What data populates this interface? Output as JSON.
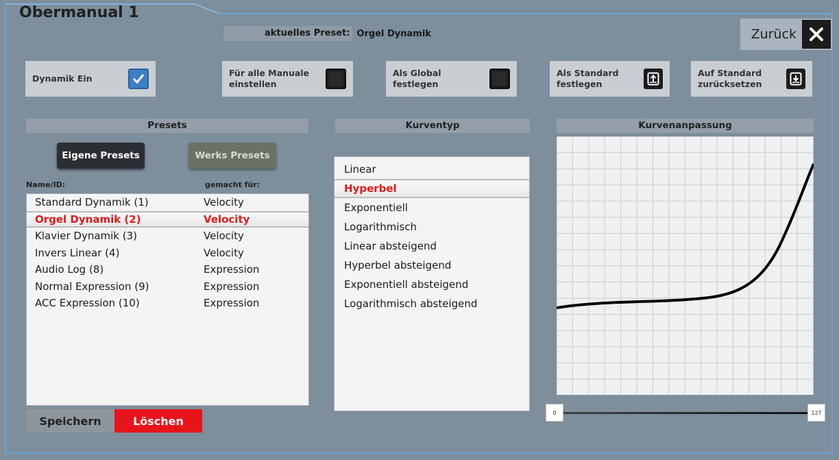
{
  "window": {
    "title": "Obermanual 1"
  },
  "current_preset": {
    "label": "aktuelles Preset:",
    "value": "Orgel Dynamik"
  },
  "back_button": {
    "label": "Zurück"
  },
  "options": {
    "dynamics": {
      "label": "Dynamik Ein",
      "checked": true
    },
    "all_manuals": {
      "line1": "Für alle Manuale",
      "line2": "einstellen",
      "checked": false
    },
    "global": {
      "line1": "Als Global",
      "line2": "festlegen",
      "checked": false
    },
    "set_standard": {
      "line1": "Als Standard",
      "line2": "festlegen"
    },
    "reset_standard": {
      "line1": "Auf Standard",
      "line2": "zurücksetzen"
    }
  },
  "presets": {
    "heading": "Presets",
    "own_button": "Eigene Presets",
    "factory_button": "Werks Presets",
    "col_name": "Name/ID:",
    "col_made_for": "gemacht für:",
    "rows": [
      {
        "name": "Standard Dynamik (1)",
        "for": "Velocity"
      },
      {
        "name": "Orgel Dynamik (2)",
        "for": "Velocity"
      },
      {
        "name": "Klavier Dynamik (3)",
        "for": "Velocity"
      },
      {
        "name": "Invers Linear (4)",
        "for": "Velocity"
      },
      {
        "name": "Audio Log (8)",
        "for": "Expression"
      },
      {
        "name": "Normal Expression (9)",
        "for": "Expression"
      },
      {
        "name": "ACC Expression (10)",
        "for": "Expression"
      }
    ],
    "selected_index": 1,
    "save_button": "Speichern",
    "delete_button": "Löschen"
  },
  "curve_types": {
    "heading": "Kurventyp",
    "items": [
      "Linear",
      "Hyperbel",
      "Exponentiell",
      "Logarithmisch",
      "Linear absteigend",
      "Hyperbel absteigend",
      "Exponentiell absteigend",
      "Logarithmisch absteigend"
    ],
    "selected_index": 1
  },
  "curve_adjust": {
    "heading": "Kurvenanpassung",
    "slider_min": "0",
    "slider_max": "127"
  },
  "colors": {
    "background": "#7d8e9c",
    "selected_text": "#e01b1b",
    "delete_button": "#e8141c",
    "checkbox_on": "#3d7fc6"
  }
}
